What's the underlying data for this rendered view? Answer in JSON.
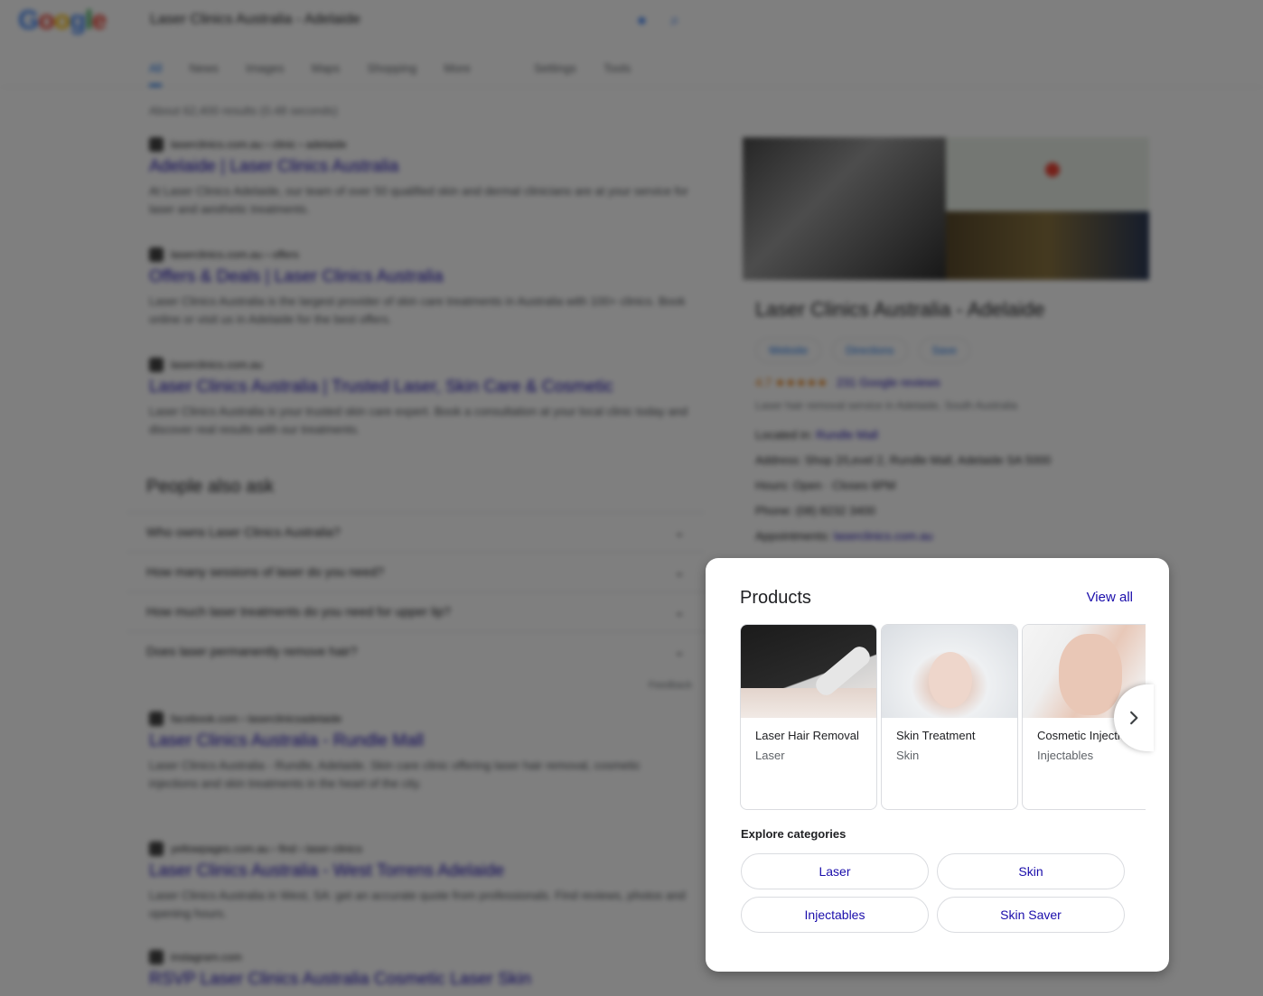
{
  "background": {
    "logo_letters": [
      "G",
      "o",
      "o",
      "g",
      "l",
      "e"
    ],
    "search_query": "Laser Clinics Australia - Adelaide",
    "tabs": [
      "All",
      "News",
      "Images",
      "Maps",
      "Shopping",
      "More",
      "Settings",
      "Tools"
    ],
    "result_stats": "About 62,400 results (0.48 seconds)",
    "results": [
      {
        "url": "laserclinics.com.au › clinic › adelaide",
        "title": "Adelaide | Laser Clinics Australia",
        "snippet": "At Laser Clinics Adelaide, our team of over 50 qualified skin and dermal clinicians are at your service for laser and aesthetic treatments."
      },
      {
        "url": "laserclinics.com.au › offers",
        "title": "Offers & Deals | Laser Clinics Australia",
        "snippet": "Laser Clinics Australia is the largest provider of skin care treatments in Australia with 100+ clinics. Book online or visit us in Adelaide for the best offers."
      },
      {
        "url": "laserclinics.com.au",
        "title": "Laser Clinics Australia | Trusted Laser, Skin Care & Cosmetic",
        "snippet": "Laser Clinics Australia is your trusted skin care expert. Book a consultation at your local clinic today and discover real results with our treatments."
      },
      {
        "url": "facebook.com › laserclinicsadelaide",
        "title": "Laser Clinics Australia - Rundle Mall",
        "snippet": "Laser Clinics Australia - Rundle, Adelaide. Skin care clinic offering laser hair removal, cosmetic injections and skin treatments in the heart of the city."
      },
      {
        "url": "yellowpages.com.au › find › laser-clinics",
        "title": "Laser Clinics Australia - West Torrens Adelaide",
        "snippet": "Laser Clinics Australia in West, SA: get an accurate quote from professionals. Find reviews, photos and opening hours."
      },
      {
        "url": "instagram.com",
        "title": "RSVP Laser Clinics Australia Cosmetic Laser Skin",
        "snippet": ""
      }
    ],
    "paa": {
      "heading": "People also ask",
      "questions": [
        "Who owns Laser Clinics Australia?",
        "How many sessions of laser do you need?",
        "How much laser treatments do you need for upper lip?",
        "Does laser permanently remove hair?"
      ],
      "feedback": "Feedback"
    },
    "knowledge_panel": {
      "title": "Laser Clinics Australia - Adelaide",
      "buttons": [
        "Website",
        "Directions",
        "Save"
      ],
      "rating": "4.7 ★★★★★",
      "reviews": "231 Google reviews",
      "subtitle": "Laser hair removal service in Adelaide, South Australia",
      "located_label": "Located in:",
      "located_value": "Rundle Mall",
      "address": "Address: Shop 2/Level 2, Rundle Mall, Adelaide SA 5000",
      "hours": "Hours: Open · Closes 6PM",
      "phone": "Phone: (08) 8232 3400",
      "appointments_label": "Appointments:",
      "appointments_value": "laserclinics.com.au"
    }
  },
  "popup": {
    "title": "Products",
    "view_all": "View all",
    "products": [
      {
        "name": "Laser Hair Removal",
        "category": "Laser",
        "image": "laser-treatment-photo"
      },
      {
        "name": "Skin Treatment",
        "category": "Skin",
        "image": "facial-treatment-photo"
      },
      {
        "name": "Cosmetic Injections",
        "category": "Injectables",
        "image": "cosmetic-injection-photo"
      }
    ],
    "explore_label": "Explore categories",
    "categories": [
      "Laser",
      "Skin",
      "Injectables",
      "Skin Saver"
    ],
    "next_icon": "chevron-right-icon"
  },
  "colors": {
    "link": "#1a0dab",
    "overlay": "rgba(0,0,0,0.5)",
    "card_border": "#dadce0"
  }
}
